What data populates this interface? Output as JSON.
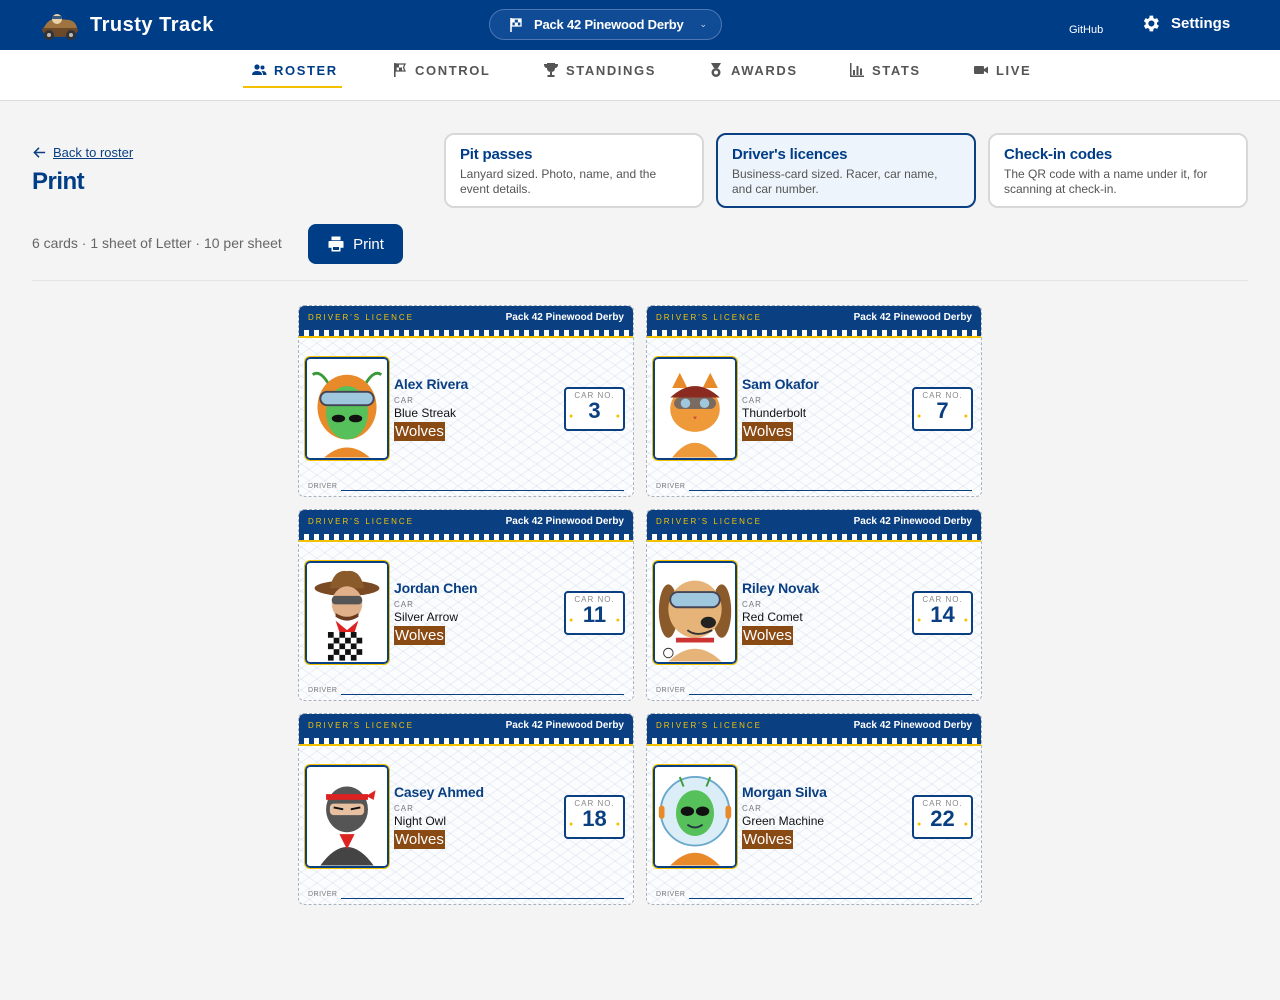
{
  "app": {
    "title": "Trusty Track",
    "logo_icon": "race-car-logo-icon"
  },
  "header": {
    "event_selector": "Pack 42 Pinewood Derby",
    "github_label": "GitHub",
    "settings_label": "Settings"
  },
  "tabs": [
    {
      "label": "ROSTER",
      "icon": "people-icon",
      "active": true
    },
    {
      "label": "CONTROL",
      "icon": "flag-icon"
    },
    {
      "label": "STANDINGS",
      "icon": "trophy-icon"
    },
    {
      "label": "AWARDS",
      "icon": "medal-icon"
    },
    {
      "label": "STATS",
      "icon": "bar-chart-icon"
    },
    {
      "label": "LIVE",
      "icon": "video-camera-icon"
    }
  ],
  "page": {
    "back_label": "Back to roster",
    "title": "Print",
    "summary": "6 cards · 1 sheet of Letter · 10 per sheet",
    "print_label": "Print"
  },
  "print_options": [
    {
      "title": "Pit passes",
      "description": "Lanyard sized. Photo, name, and the event details.",
      "selected": false
    },
    {
      "title": "Driver's licences",
      "description": "Business-card sized. Racer, car name, and car number.",
      "selected": true
    },
    {
      "title": "Check-in codes",
      "description": "The QR code with a name under it, for scanning at check-in.",
      "selected": false
    }
  ],
  "card_labels": {
    "kind": "DRIVER'S LICENCE",
    "event": "Pack 42 Pinewood Derby",
    "car": "CAR",
    "car_no": "CAR NO.",
    "driver": "DRIVER"
  },
  "cards": [
    {
      "racer": "Alex Rivera",
      "car_name": "Blue Streak",
      "den": "Wolves",
      "car_number": "3",
      "avatar": "alien-helmet-avatar-icon"
    },
    {
      "racer": "Sam Okafor",
      "car_name": "Thunderbolt",
      "den": "Wolves",
      "car_number": "7",
      "avatar": "cat-helmet-avatar-icon"
    },
    {
      "racer": "Jordan Chen",
      "car_name": "Silver Arrow",
      "den": "Wolves",
      "car_number": "11",
      "avatar": "cowboy-racer-avatar-icon"
    },
    {
      "racer": "Riley Novak",
      "car_name": "Red Comet",
      "den": "Wolves",
      "car_number": "14",
      "avatar": "dog-goggles-avatar-icon"
    },
    {
      "racer": "Casey Ahmed",
      "car_name": "Night Owl",
      "den": "Wolves",
      "car_number": "18",
      "avatar": "ninja-avatar-icon"
    },
    {
      "racer": "Morgan Silva",
      "car_name": "Green Machine",
      "den": "Wolves",
      "car_number": "22",
      "avatar": "alien-astronaut-avatar-icon"
    }
  ],
  "colors": {
    "brand_blue": "#003d87",
    "accent_yellow": "#f2c200",
    "den_brown": "#8a4a14"
  }
}
